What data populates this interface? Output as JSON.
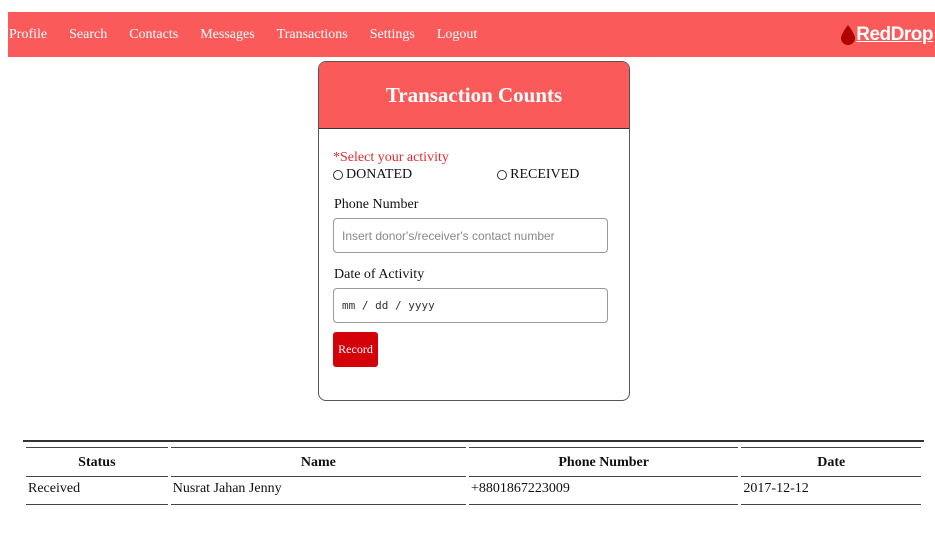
{
  "nav": {
    "links": [
      "Profile",
      "Search",
      "Contacts",
      "Messages",
      "Transactions",
      "Settings",
      "Logout"
    ],
    "brand": "RedDrop"
  },
  "colors": {
    "navbar": "#fa5a5a",
    "header": "#fa5a5a",
    "button": "#d4000a",
    "required": "#e32b2b"
  },
  "form": {
    "title": "Transaction Counts",
    "activity_label": "*Select your activity",
    "options": [
      "DONATED",
      "RECEIVED"
    ],
    "phone_label": "Phone Number",
    "phone_placeholder": "Insert donor's/receiver's contact number",
    "date_label": "Date of Activity",
    "date_placeholder": "mm / dd / yyyy",
    "submit_label": "Record"
  },
  "table": {
    "headers": [
      "Status",
      "Name",
      "Phone Number",
      "Date"
    ],
    "rows": [
      [
        "Received",
        "Nusrat Jahan Jenny",
        "+8801867223009",
        "2017-12-12"
      ]
    ]
  }
}
